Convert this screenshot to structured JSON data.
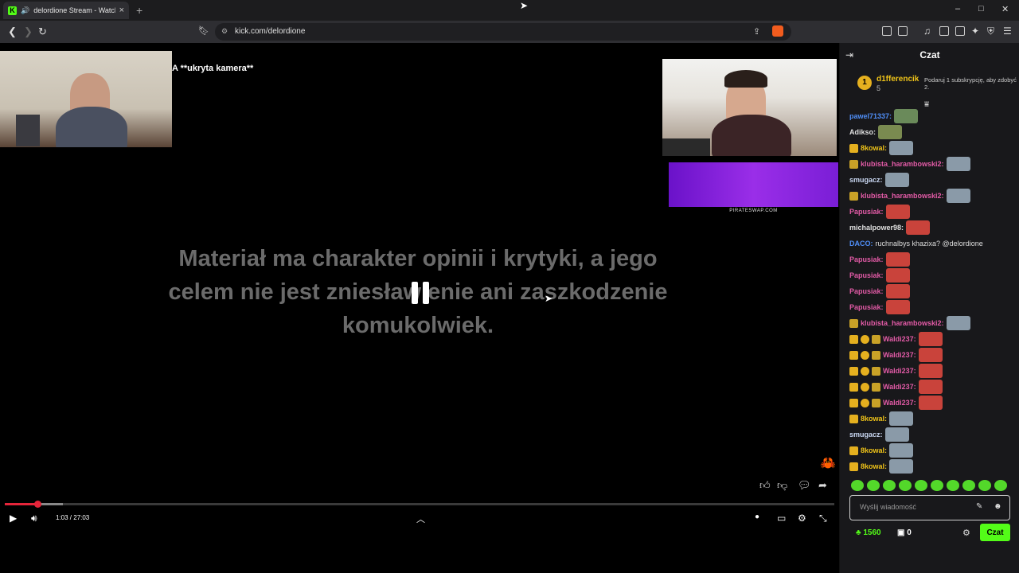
{
  "browser": {
    "tab_title": "delordione Stream - Watch Li",
    "favicon_letter": "K",
    "url": "kick.com/delordione",
    "min_symbol": "–",
    "max_symbol": "□",
    "close_symbol": "✕"
  },
  "stream": {
    "overlay_title": "A **ukryta kamera**",
    "disclaimer": "Materiał ma charakter opinii i krytyki, a jego celem nie jest zniesławienie ani zaszkodzenie komukolwiek.",
    "ad_label": "PIRATESWAP.COM",
    "progress_fraction": 0.039,
    "buffer_fraction": 0.07
  },
  "player": {
    "time_current": "1:03",
    "time_total": "27:03",
    "time_display": "1:03 / 27:03"
  },
  "chat": {
    "title": "Czat",
    "pinned": {
      "badge": "1",
      "user": "d1fferencik",
      "count": "5",
      "text": "Podaruj 1 subskrypcję, aby zdobyć 2."
    },
    "messages": [
      {
        "user": "pawel71337",
        "color": "#4f8ef7",
        "badges": [],
        "text": "",
        "emote": "#6a8a5a"
      },
      {
        "user": "Adikso",
        "color": "#e0e0e0",
        "badges": [],
        "text": "",
        "emote": "#7a8a50"
      },
      {
        "user": "8kowal",
        "color": "#f0c419",
        "badges": [
          "crown"
        ],
        "text": "",
        "emote": "#8a9aa8"
      },
      {
        "user": "klubista_harambowski2",
        "color": "#e35ba7",
        "badges": [
          "shield"
        ],
        "text": "",
        "emote": "#8a9aa8"
      },
      {
        "user": "smugacz",
        "color": "#c9d7f2",
        "badges": [],
        "text": "",
        "emote": "#8a9aa8"
      },
      {
        "user": "klubista_harambowski2",
        "color": "#e35ba7",
        "badges": [
          "shield"
        ],
        "text": "",
        "emote": "#8a9aa8"
      },
      {
        "user": "Papusiak",
        "color": "#e35ba7",
        "badges": [],
        "text": "",
        "emote": "#c9433b"
      },
      {
        "user": "michalpower98",
        "color": "#e0e0e0",
        "badges": [],
        "text": "",
        "emote": "#c9433b"
      },
      {
        "user": "DACO",
        "color": "#4f8ef7",
        "badges": [],
        "text": "ruchnalbys khazixa? @delordione",
        "emote": ""
      },
      {
        "user": "Papusiak",
        "color": "#e35ba7",
        "badges": [],
        "text": "",
        "emote": "#c9433b"
      },
      {
        "user": "Papusiak",
        "color": "#e35ba7",
        "badges": [],
        "text": "",
        "emote": "#c9433b"
      },
      {
        "user": "Papusiak",
        "color": "#e35ba7",
        "badges": [],
        "text": "",
        "emote": "#c9433b"
      },
      {
        "user": "Papusiak",
        "color": "#e35ba7",
        "badges": [],
        "text": "",
        "emote": "#c9433b"
      },
      {
        "user": "klubista_harambowski2",
        "color": "#e35ba7",
        "badges": [
          "shield"
        ],
        "text": "",
        "emote": "#8a9aa8"
      },
      {
        "user": "Waldi237",
        "color": "#e35ba7",
        "badges": [
          "crown",
          "coin",
          "shield"
        ],
        "text": "",
        "emote": "#c9433b"
      },
      {
        "user": "Waldi237",
        "color": "#e35ba7",
        "badges": [
          "crown",
          "coin",
          "shield"
        ],
        "text": "",
        "emote": "#c9433b"
      },
      {
        "user": "Waldi237",
        "color": "#e35ba7",
        "badges": [
          "crown",
          "coin",
          "shield"
        ],
        "text": "",
        "emote": "#c9433b"
      },
      {
        "user": "Waldi237",
        "color": "#e35ba7",
        "badges": [
          "crown",
          "coin",
          "shield"
        ],
        "text": "",
        "emote": "#c9433b"
      },
      {
        "user": "Waldi237",
        "color": "#e35ba7",
        "badges": [
          "crown",
          "coin",
          "shield"
        ],
        "text": "",
        "emote": "#c9433b"
      },
      {
        "user": "8kowal",
        "color": "#f0c419",
        "badges": [
          "crown"
        ],
        "text": "",
        "emote": "#8a9aa8"
      },
      {
        "user": "smugacz",
        "color": "#c9d7f2",
        "badges": [],
        "text": "",
        "emote": "#8a9aa8"
      },
      {
        "user": "8kowal",
        "color": "#f0c419",
        "badges": [
          "crown"
        ],
        "text": "",
        "emote": "#8a9aa8"
      },
      {
        "user": "8kowal",
        "color": "#f0c419",
        "badges": [
          "crown"
        ],
        "text": "",
        "emote": "#8a9aa8"
      }
    ],
    "input_placeholder": "Wyślij wiadomość",
    "points": "1560",
    "points_secondary": "0",
    "send_label": "Czat"
  },
  "colors": {
    "accent": "#53fc18",
    "progress": "#e5253a",
    "badge_gold": "#e5b01f"
  }
}
